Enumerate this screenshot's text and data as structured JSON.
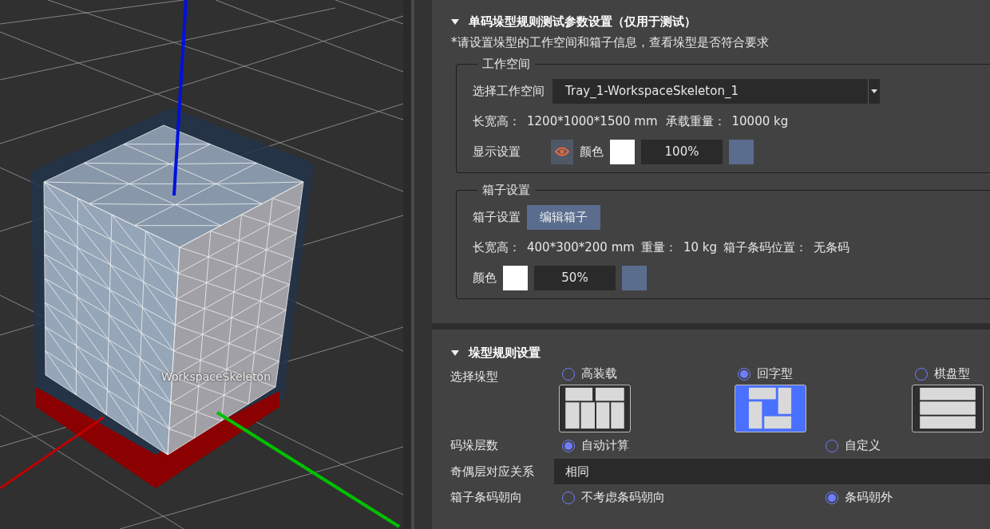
{
  "viewport": {
    "label": "WorkspaceSkeleton"
  },
  "test_section": {
    "title": "单码垛型规则测试参数设置（仅用于测试）",
    "expanded": true,
    "note": "*请设置垛型的工作空间和箱子信息，查看垛型是否符合要求",
    "workspace_group": {
      "legend": "工作空间",
      "select_label": "选择工作空间",
      "select_value": "Tray_1-WorkspaceSkeleton_1",
      "dims_label": "长宽高：",
      "dims_value": "1200*1000*1500 mm",
      "load_label": "承载重量：",
      "load_value": "10000 kg",
      "display_label": "显示设置",
      "visible": true,
      "color_label": "颜色",
      "opacity": "100%"
    },
    "box_group": {
      "legend": "箱子设置",
      "setting_label": "箱子设置",
      "edit_button": "编辑箱子",
      "dims_label": "长宽高：",
      "dims_value": "400*300*200 mm",
      "weight_label": "重量：",
      "weight_value": "10 kg",
      "barcode_label": "箱子条码位置：",
      "barcode_value": "无条码",
      "color_label": "颜色",
      "opacity": "50%"
    }
  },
  "rule_section": {
    "title": "垛型规则设置",
    "expanded": true,
    "pattern_label": "选择垛型",
    "patterns": [
      {
        "label": "高装载",
        "kind": "high-load",
        "selected": false
      },
      {
        "label": "回字型",
        "kind": "pinwheel",
        "selected": true
      },
      {
        "label": "棋盘型",
        "kind": "stripes",
        "selected": false
      }
    ],
    "layers_label": "码垛层数",
    "layers_options": [
      {
        "label": "自动计算",
        "selected": true
      },
      {
        "label": "自定义",
        "selected": false
      }
    ],
    "parity_label": "奇偶层对应关系",
    "parity_value": "相同",
    "barcode_label": "箱子条码朝向",
    "barcode_options": [
      {
        "label": "不考虑条码朝向",
        "selected": false
      },
      {
        "label": "条码朝外",
        "selected": true
      }
    ]
  }
}
